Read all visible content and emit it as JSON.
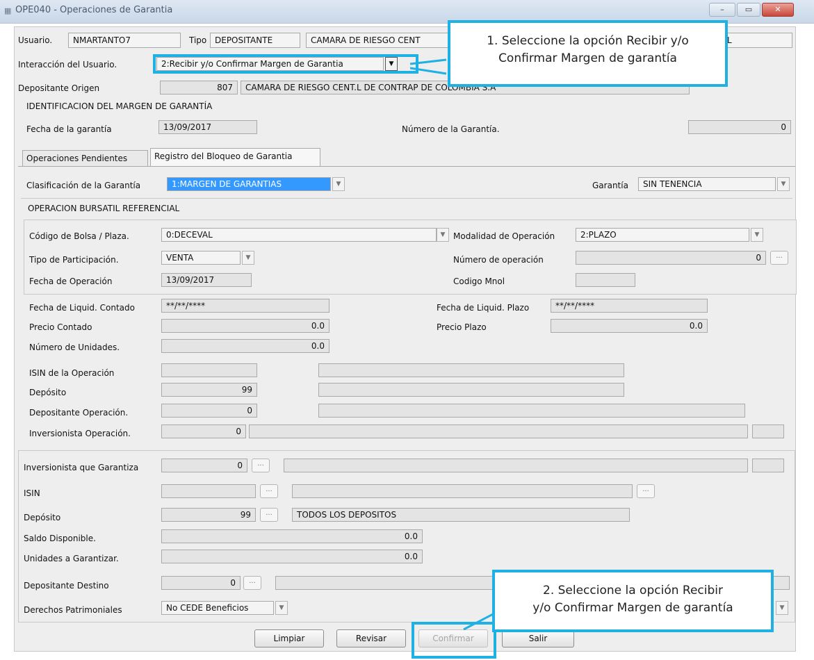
{
  "window": {
    "title": "OPE040 - Operaciones de Garantia"
  },
  "header": {
    "usuario_label": "Usuario.",
    "usuario_value": "NMARTANTO7",
    "tipo_label": "Tipo",
    "tipo_value": "DEPOSITANTE",
    "entidad_value": "CAMARA DE RIESGO CENT",
    "entidad_tail": "L",
    "interaccion_label": "Interacción del Usuario.",
    "interaccion_value": "2:Recibir y/o Confirmar Margen de Garantia",
    "depositante_origen_label": "Depositante Origen",
    "depositante_origen_code": "807",
    "depositante_origen_name": "CAMARA DE RIESGO CENT.L DE CONTRAP DE COLOMBIA S.A"
  },
  "identificacion": {
    "section_title": "IDENTIFICACION DEL MARGEN DE GARANTÍA",
    "fecha_label": "Fecha de la garantía",
    "fecha_value": "13/09/2017",
    "numero_label": "Número de la Garantía.",
    "numero_value": "0"
  },
  "tabs": [
    {
      "label": "Operaciones Pendientes"
    },
    {
      "label": "Registro del Bloqueo de Garantia"
    }
  ],
  "registro": {
    "clasificacion_label": "Clasificación de la Garantía",
    "clasificacion_value": "1:MARGEN DE GARANTIAS",
    "garantia_label": "Garantía",
    "garantia_value": "SIN TENENCIA",
    "op_bursatil_title": "OPERACION BURSATIL REFERENCIAL",
    "codigo_bolsa_label": "Código de Bolsa / Plaza.",
    "codigo_bolsa_value": "0:DECEVAL",
    "modalidad_label": "Modalidad de Operación",
    "modalidad_value": "2:PLAZO",
    "tipo_participacion_label": "Tipo de Participación.",
    "tipo_participacion_value": "VENTA",
    "numero_operacion_label": "Número de operación",
    "numero_operacion_value": "0",
    "fecha_operacion_label": "Fecha de Operación",
    "fecha_operacion_value": "13/09/2017",
    "codigo_mnol_label": "Codigo Mnol",
    "fecha_liq_contado_label": "Fecha de Liquid. Contado",
    "fecha_liq_contado_value": "**/**/****",
    "fecha_liq_plazo_label": "Fecha de Liquid. Plazo",
    "fecha_liq_plazo_value": "**/**/****",
    "precio_contado_label": "Precio Contado",
    "precio_contado_value": "0.0",
    "precio_plazo_label": "Precio Plazo",
    "precio_plazo_value": "0.0",
    "numero_unidades_label": "Número de Unidades.",
    "numero_unidades_value": "0.0",
    "isin_operacion_label": "ISIN de la Operación",
    "deposito_label": "Depósito",
    "deposito_value": "99",
    "depositante_operacion_label": "Depositante Operación.",
    "depositante_operacion_value": "0",
    "inversionista_operacion_label": "Inversionista Operación.",
    "inversionista_operacion_value": "0"
  },
  "garantiza": {
    "inversionista_label": "Inversionista que Garantiza",
    "inversionista_value": "0",
    "isin_label": "ISIN",
    "deposito_label": "Depósito",
    "deposito_value": "99",
    "deposito_name": "TODOS LOS DEPOSITOS",
    "saldo_label": "Saldo Disponible.",
    "saldo_value": "0.0",
    "unidades_label": "Unidades a Garantizar.",
    "unidades_value": "0.0",
    "depositante_destino_label": "Depositante Destino",
    "depositante_destino_value": "0",
    "derechos_label": "Derechos Patrimoniales",
    "derechos_value": "No CEDE Beneficios"
  },
  "buttons": {
    "limpiar": "Limpiar",
    "revisar": "Revisar",
    "confirmar": "Confirmar",
    "salir": "Salir"
  },
  "callouts": {
    "step1_line1": "1. Seleccione la opción Recibir y/o",
    "step1_line2": "Confirmar Margen de garantía",
    "step2_line1": "2. Seleccione la opción Recibir",
    "step2_line2": "y/o Confirmar Margen de garantía"
  },
  "ui": {
    "dots": "...",
    "dropdown_glyph": "▼",
    "accent_color": "#1fb0e4",
    "selection_color": "#3399ff"
  }
}
